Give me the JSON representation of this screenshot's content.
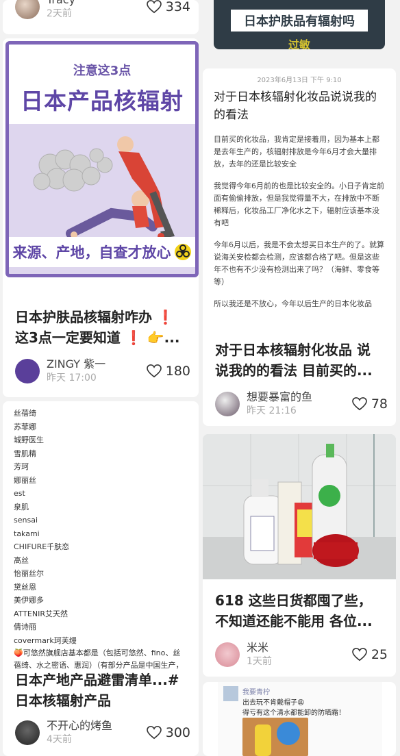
{
  "left_column": {
    "card1": {
      "author": "Tracy",
      "time": "2天前",
      "likes": "334"
    },
    "card2": {
      "cover": {
        "subtitle": "注意这3点",
        "headline": "日本产品核辐射",
        "footer": "来源、产地，自查才放心"
      },
      "title": "日本护肤品核辐射咋办 ❗这3点一定要知道 ❗ 👉...",
      "author": "ZINGY 紫一",
      "time": "昨天 17:00",
      "likes": "180"
    },
    "card3": {
      "brands": [
        "丝蓓绮",
        "苏菲娜",
        "城野医生",
        "雪肌精",
        "芳珂",
        "娜丽丝",
        "est",
        "泉肌",
        "sensai",
        "takami",
        "CHIFURE千肤恋",
        "高丝",
        "怡丽丝尔",
        "黛丝恩",
        "美伊娜多",
        "ATTENIR艾天然",
        "倩诗丽",
        "covermark珂芙缦"
      ],
      "note": "🍑可悠然旗舰店基本都是（包括可悠然、fino、丝蓓绮、水之密语、惠润）（有部分产品是中国生产，需要注意辨别）",
      "title": "日本产地产品避雷清单...#日本核辐射产品",
      "author": "不开心的烤鱼",
      "time": "4天前",
      "likes": "300"
    }
  },
  "right_column": {
    "card1": {
      "cover_text": "日本护肤品有辐射吗",
      "cover_sub": "过敏"
    },
    "card2": {
      "doc": {
        "date": "2023年6月13日 下午 9:10",
        "title": "对于日本核辐射化妆品说说我的的看法",
        "paragraphs": [
          "目前买的化妆品，我肯定是接着用，因为基本上都是去年生产的，核辐射排放是今年6月才会大量排放，去年的还是比较安全",
          "我觉得今年6月前的也是比较安全的。小日子肯定前面有偷偷排放，但是我觉得量不大，在排放中不断稀释后，化妆品工厂净化水之下，辐射应该基本没有吧",
          "今年6月以后，我是不会太想买日本生产的了。就算说海关安检都会检测，应该都合格了吧。但是这些年不也有不少没有检测出来了吗？（海鲜、零食等等）",
          "所以我还是不放心，今年以后生产的日本化妆品"
        ]
      },
      "title": "对于日本核辐射化妆品 说说我的的看法 目前买的...",
      "author": "想要暴富的鱼",
      "time": "昨天 21:16",
      "likes": "78"
    },
    "card3": {
      "title": "618 这些日货都囤了些，不知道还能不能用 各位...",
      "author": "米米",
      "time": "1天前",
      "likes": "25"
    },
    "card4": {
      "chat_name": "我要青柠",
      "chat_line1": "出去玩不肯戴帽子😩",
      "chat_line2": "得亏有这个清水都能卸的防晒霜！"
    }
  },
  "colors": {
    "accent_purple": "#5e46a6",
    "frame_purple": "#7e65b8",
    "muted": "#aaaaaa"
  }
}
